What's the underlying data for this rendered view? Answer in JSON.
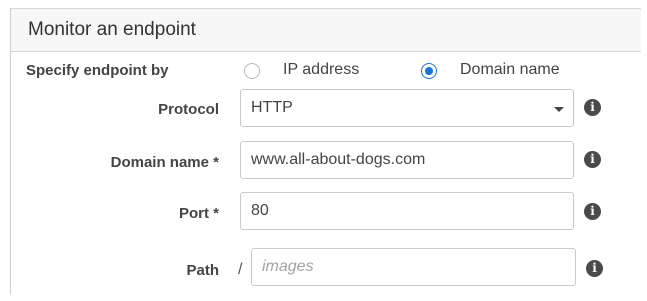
{
  "panel": {
    "title": "Monitor an endpoint"
  },
  "specify": {
    "label": "Specify endpoint by",
    "options": [
      {
        "label": "IP address",
        "selected": false
      },
      {
        "label": "Domain name",
        "selected": true
      }
    ]
  },
  "protocol": {
    "label": "Protocol",
    "value": "HTTP",
    "info_icon": "info-circle-icon"
  },
  "domain": {
    "label": "Domain name *",
    "value": "www.all-about-dogs.com",
    "info_icon": "info-circle-icon"
  },
  "port": {
    "label": "Port *",
    "value": "80",
    "info_icon": "info-circle-icon"
  },
  "path": {
    "label": "Path",
    "prefix": "/",
    "placeholder": "images",
    "info_icon": "info-circle-icon"
  },
  "info_glyph": "i",
  "colors": {
    "accent": "#1a73d6",
    "header_bg": "#f7f7f7",
    "border": "#c9c9c9"
  }
}
